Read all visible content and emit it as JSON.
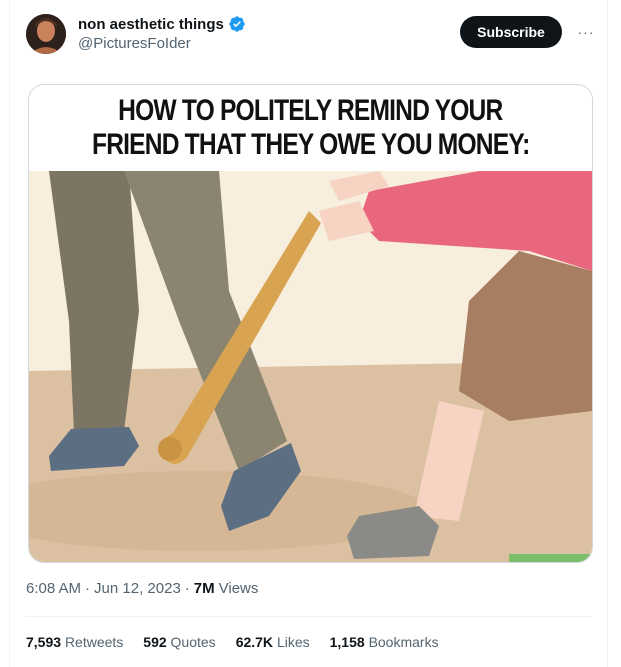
{
  "author": {
    "display_name": "non aesthetic things",
    "handle": "@PicturesFoIder",
    "verified": true,
    "verified_color": "#1d9bf0"
  },
  "actions": {
    "subscribe_label": "Subscribe",
    "more_label": "···"
  },
  "media": {
    "caption_line1": "HOW TO POLITELY REMIND YOUR",
    "caption_line2": "FRIEND THAT THEY OWE YOU MONEY:"
  },
  "meta": {
    "time": "6:08 AM",
    "date": "Jun 12, 2023",
    "views_count": "7M",
    "views_label": "Views"
  },
  "stats": [
    {
      "count": "7,593",
      "label": "Retweets"
    },
    {
      "count": "592",
      "label": "Quotes"
    },
    {
      "count": "62.7K",
      "label": "Likes"
    },
    {
      "count": "1,158",
      "label": "Bookmarks"
    }
  ]
}
